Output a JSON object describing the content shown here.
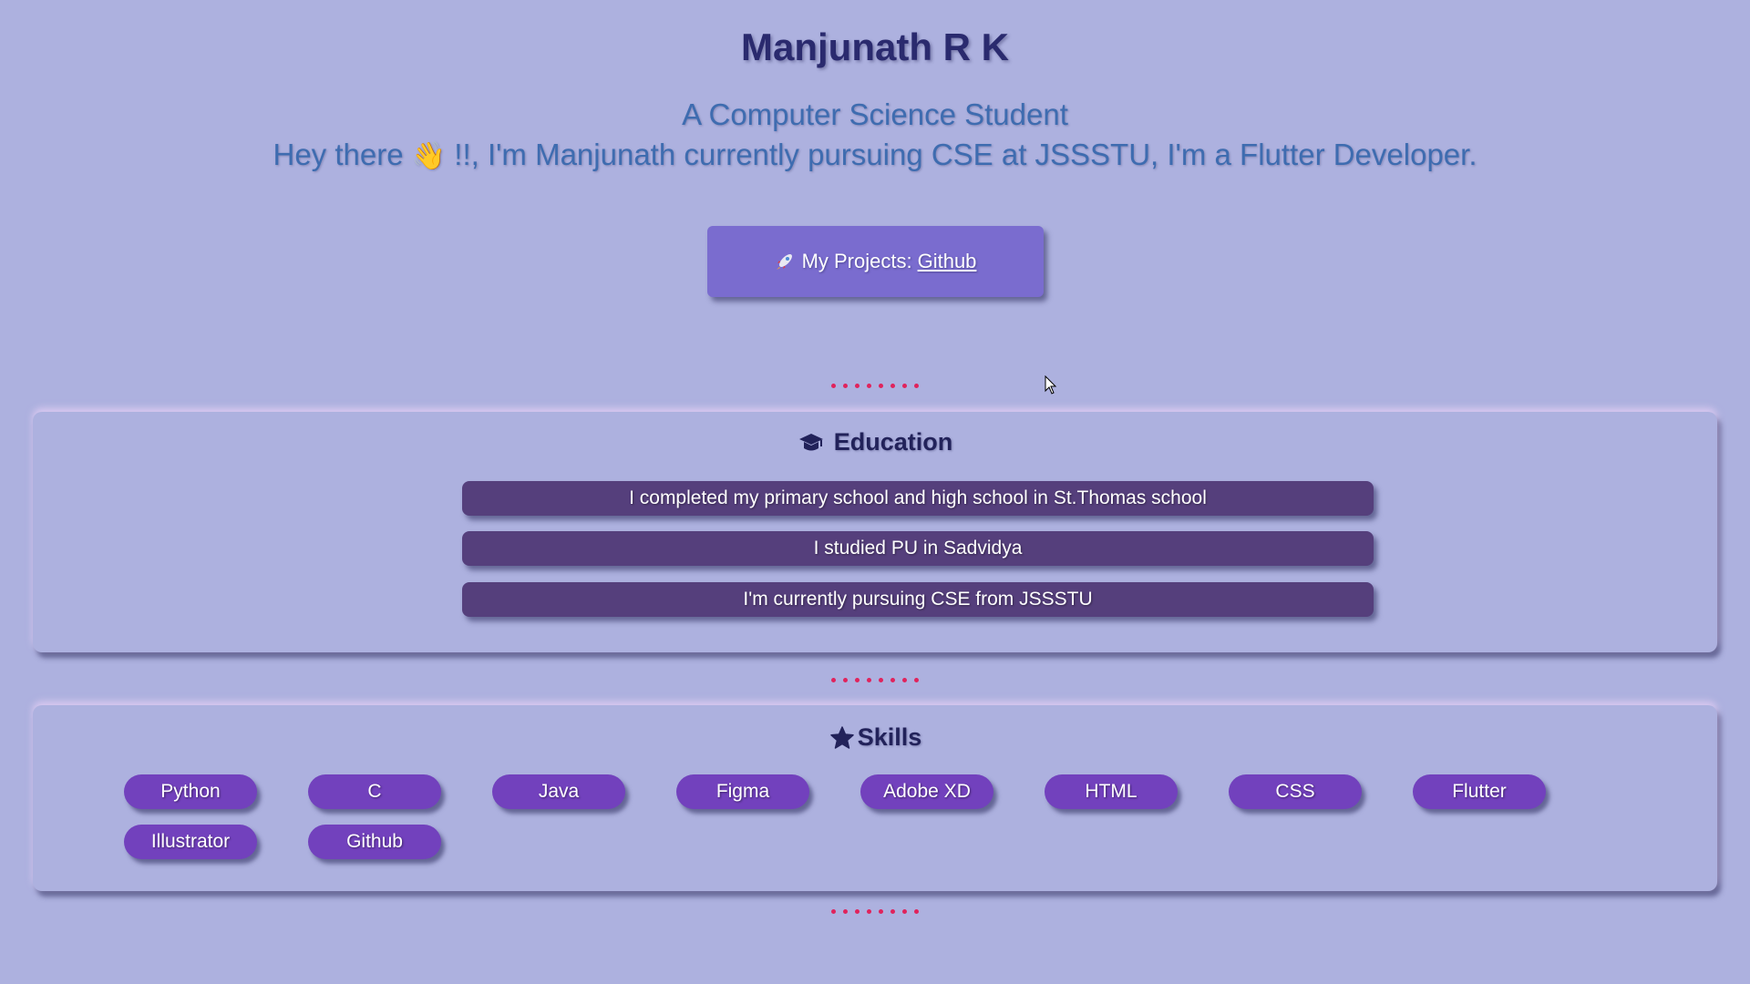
{
  "hero": {
    "name": "Manjunath R K",
    "tagline": "A Computer Science Student",
    "intro_prefix": "Hey there ",
    "intro_wave": "👋",
    "intro_suffix": "!!, I'm Manjunath currently pursuing CSE at JSSSTU, I'm a Flutter Developer."
  },
  "projects": {
    "label": "My Projects:",
    "link_text": "Github",
    "icon": "rocket-icon"
  },
  "education": {
    "title": "Education",
    "icon": "graduation-cap-icon",
    "items": [
      "I completed my primary school and high school in St.Thomas school",
      "I studied PU in Sadvidya",
      "I'm currently pursuing CSE from JSSSTU"
    ]
  },
  "skills": {
    "title": "Skills",
    "icon": "star-icon",
    "items": [
      "Python",
      "C",
      "Java",
      "Figma",
      "Adobe XD",
      "HTML",
      "CSS",
      "Flutter",
      "Illustrator",
      "Github"
    ]
  },
  "colors": {
    "background": "#adb1df",
    "accent_dots": "#e0235c",
    "education_item": "#553f7c",
    "skill_pill": "#7241bd",
    "projects_button": "#7a6ccf"
  }
}
